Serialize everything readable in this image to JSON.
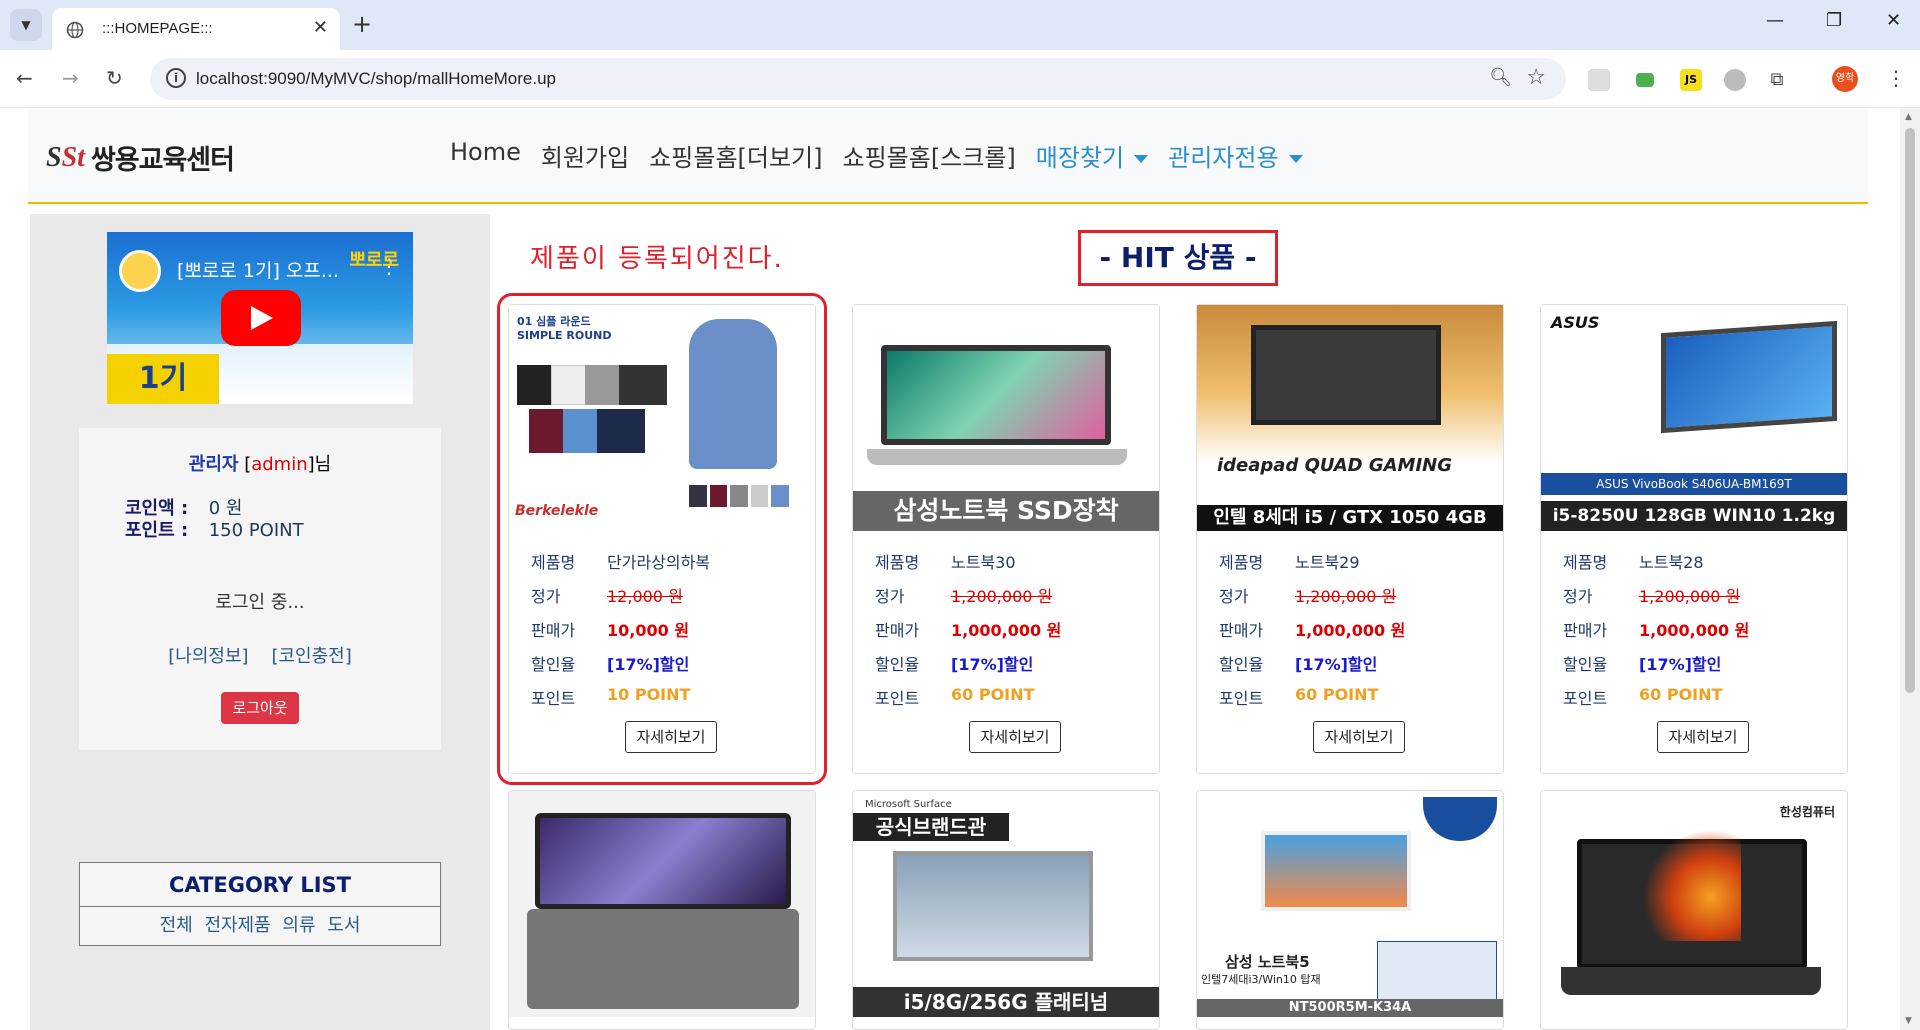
{
  "browser": {
    "tab_title": ":::HOMEPAGE:::",
    "url": "localhost:9090/MyMVC/shop/mallHomeMore.up",
    "profile_initial": "영학",
    "ext_js": "JS"
  },
  "site": {
    "logo_mark": "SSt",
    "logo_text": "쌍용교육센터",
    "menu": [
      {
        "label": "Home"
      },
      {
        "label": "회원가입"
      },
      {
        "label": "쇼핑몰홈[더보기]"
      },
      {
        "label": "쇼핑몰홈[스크롤]"
      },
      {
        "label": "매장찾기"
      },
      {
        "label": "관리자전용"
      }
    ]
  },
  "sidebar": {
    "video_title": "[뽀로로 1기] 오프...",
    "video_badge": "1기",
    "video_brand": "뽀로로",
    "user_name": "관리자",
    "user_id": "admin",
    "user_suffix": "님",
    "coin_label": "코인액 :",
    "coin_value": "0 원",
    "point_label": "포인트 :",
    "point_value": "150 POINT",
    "status": "로그인 중...",
    "link_myinfo": "[나의정보]",
    "link_coin": "[코인충전]",
    "logout_label": "로그아웃",
    "category_title": "CATEGORY LIST",
    "categories": [
      "전체",
      "전자제품",
      "의류",
      "도서"
    ]
  },
  "main": {
    "register_note": "제품이 등록되어진다.",
    "hit_title": "- HIT 상품 -",
    "labels": {
      "name": "제품명",
      "list_price": "정가",
      "sale_price": "판매가",
      "discount": "할인율",
      "point": "포인트"
    },
    "detail_label": "자세히보기",
    "products": [
      {
        "name": "단가라상의하복",
        "list_price": "12,000 원",
        "sale_price": "10,000 원",
        "discount": "[17%]할인",
        "point": "10 POINT",
        "img_text": "01 심플 라운드 SIMPLE ROUND",
        "img_brand": "Berkelekle"
      },
      {
        "name": "노트북30",
        "list_price": "1,200,000 원",
        "sale_price": "1,000,000 원",
        "discount": "[17%]할인",
        "point": "60 POINT",
        "img_text": "삼성노트북 SSD장착"
      },
      {
        "name": "노트북29",
        "list_price": "1,200,000 원",
        "sale_price": "1,000,000 원",
        "discount": "[17%]할인",
        "point": "60 POINT",
        "img_text": "인텔 8세대 i5 / GTX 1050 4GB",
        "img_brand": "ideapad QUAD GAMING"
      },
      {
        "name": "노트북28",
        "list_price": "1,200,000 원",
        "sale_price": "1,000,000 원",
        "discount": "[17%]할인",
        "point": "60 POINT",
        "img_text": "i5-8250U 128GB WIN10 1.2kg",
        "img_brand": "ASUS VivoBook S406UA-BM169T"
      }
    ],
    "row2": [
      {
        "img_text": ""
      },
      {
        "img_text": "i5/8G/256G 플래티넘",
        "img_brand": "공식브랜드관",
        "img_small": "Microsoft Surface"
      },
      {
        "img_text": "NT500R5M-K34A",
        "img_brand": "삼성 노트북5",
        "img_small": "인텔7세대i3/Win10 탑재"
      },
      {
        "img_text": "",
        "img_brand": "한성컴퓨터"
      }
    ]
  }
}
